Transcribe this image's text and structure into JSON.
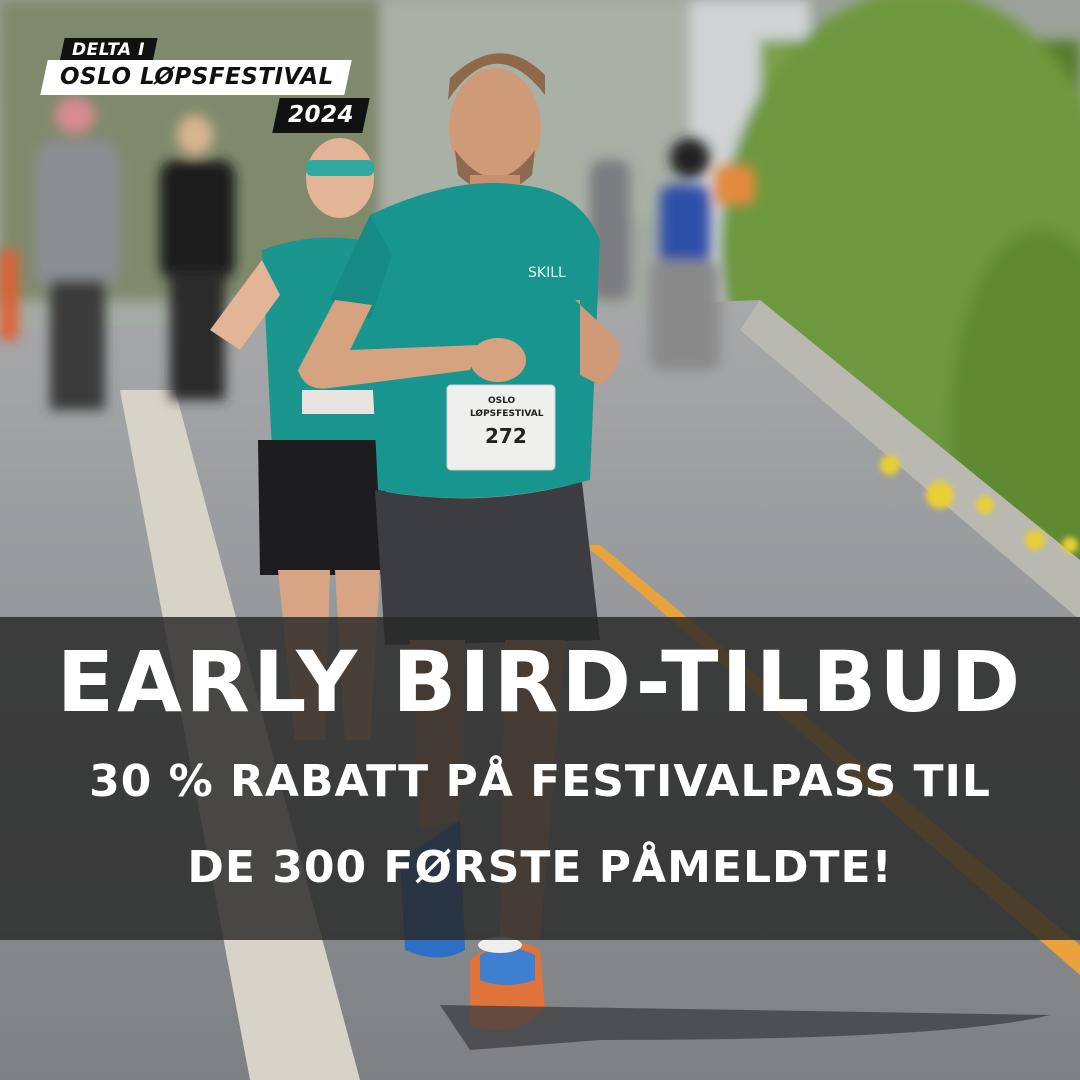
{
  "logo": {
    "prefix": "DELTA I",
    "name": "OSLO LØPSFESTIVAL",
    "year": "2024"
  },
  "banner": {
    "headline": "EARLY BIRD-TILBUD",
    "line1": "30 % RABATT PÅ FESTIVALPASS TIL",
    "line2": "DE 300 FØRSTE PÅMELDTE!"
  },
  "photo": {
    "bib_number": "272",
    "bib_event": "OSLO LØPSFESTIVAL",
    "shirt_brand": "SKILL"
  },
  "colors": {
    "banner_bg": "#282828",
    "shirt_teal": "#17958e",
    "road_line": "#e9a33a",
    "hedge_green": "#6f9a3a"
  }
}
